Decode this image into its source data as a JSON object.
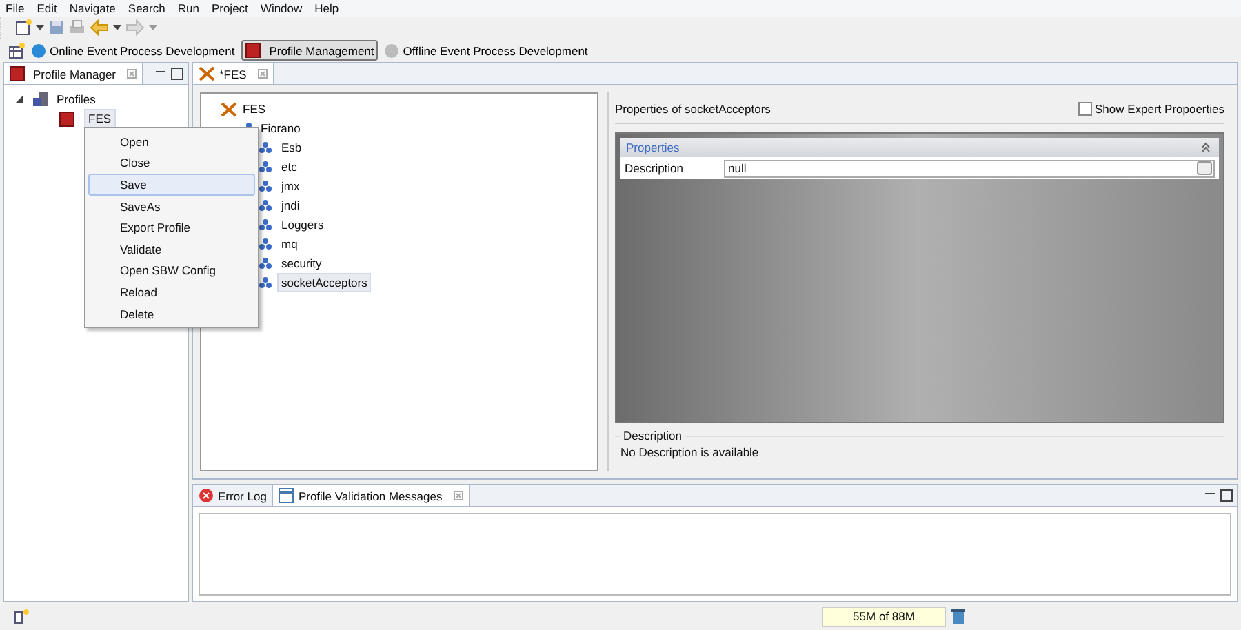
{
  "menu_bar": [
    "File",
    "Edit",
    "Navigate",
    "Search",
    "Run",
    "Project",
    "Window",
    "Help"
  ],
  "perspectives": [
    {
      "label": "Online Event Process Development",
      "selected": false
    },
    {
      "label": "Profile Management",
      "selected": true
    },
    {
      "label": "Offline Event Process Development",
      "selected": false
    }
  ],
  "profile_manager": {
    "title": "Profile Manager",
    "tree": [
      {
        "label": "Profiles",
        "expanded": true,
        "children": [
          {
            "label": "FES",
            "selected": true
          }
        ]
      }
    ]
  },
  "context_menu": {
    "items": [
      {
        "label": "Open",
        "selected": false
      },
      {
        "label": "Close",
        "selected": false
      },
      {
        "label": "Save",
        "selected": true
      },
      {
        "label": "SaveAs",
        "selected": false
      },
      {
        "label": "Export Profile",
        "selected": false
      },
      {
        "label": "Validate",
        "selected": false
      },
      {
        "label": "Open SBW Config",
        "selected": false
      },
      {
        "label": "Reload",
        "selected": false
      },
      {
        "label": "Delete",
        "selected": false
      }
    ]
  },
  "editor": {
    "tab": "*FES",
    "tree": {
      "label": "FES",
      "children": [
        {
          "label": "Fiorano",
          "children": [
            {
              "label": "Esb",
              "selected": false
            },
            {
              "label": "etc",
              "selected": false
            },
            {
              "label": "jmx",
              "selected": false
            },
            {
              "label": "jndi",
              "selected": false
            },
            {
              "label": "Loggers",
              "selected": false
            },
            {
              "label": "mq",
              "selected": false
            },
            {
              "label": "security",
              "selected": false
            },
            {
              "label": "socketAcceptors",
              "selected": true
            }
          ]
        }
      ]
    },
    "properties": {
      "title": "Properties of socketAcceptors",
      "show_expert": {
        "label": "Show Expert Propoerties",
        "checked": false
      },
      "section_title": "Properties",
      "rows": [
        {
          "label": "Description",
          "value": "null"
        }
      ],
      "description": {
        "legend": "Description",
        "text": "No Description is available"
      }
    }
  },
  "bottom_tabs": [
    {
      "label": "Error Log",
      "selected": false
    },
    {
      "label": "Profile Validation Messages",
      "selected": true
    }
  ],
  "status_bar": {
    "memory": "55M of 88M"
  }
}
